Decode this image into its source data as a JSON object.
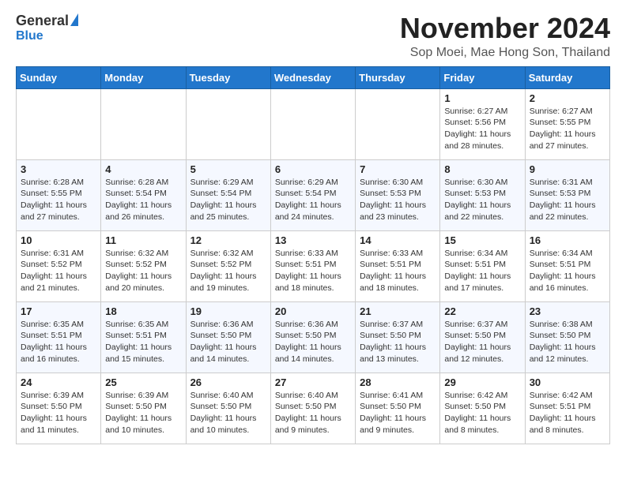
{
  "header": {
    "logo_general": "General",
    "logo_blue": "Blue",
    "month_title": "November 2024",
    "subtitle": "Sop Moei, Mae Hong Son, Thailand"
  },
  "days_of_week": [
    "Sunday",
    "Monday",
    "Tuesday",
    "Wednesday",
    "Thursday",
    "Friday",
    "Saturday"
  ],
  "weeks": [
    [
      {
        "day": "",
        "info": ""
      },
      {
        "day": "",
        "info": ""
      },
      {
        "day": "",
        "info": ""
      },
      {
        "day": "",
        "info": ""
      },
      {
        "day": "",
        "info": ""
      },
      {
        "day": "1",
        "info": "Sunrise: 6:27 AM\nSunset: 5:56 PM\nDaylight: 11 hours\nand 28 minutes."
      },
      {
        "day": "2",
        "info": "Sunrise: 6:27 AM\nSunset: 5:55 PM\nDaylight: 11 hours\nand 27 minutes."
      }
    ],
    [
      {
        "day": "3",
        "info": "Sunrise: 6:28 AM\nSunset: 5:55 PM\nDaylight: 11 hours\nand 27 minutes."
      },
      {
        "day": "4",
        "info": "Sunrise: 6:28 AM\nSunset: 5:54 PM\nDaylight: 11 hours\nand 26 minutes."
      },
      {
        "day": "5",
        "info": "Sunrise: 6:29 AM\nSunset: 5:54 PM\nDaylight: 11 hours\nand 25 minutes."
      },
      {
        "day": "6",
        "info": "Sunrise: 6:29 AM\nSunset: 5:54 PM\nDaylight: 11 hours\nand 24 minutes."
      },
      {
        "day": "7",
        "info": "Sunrise: 6:30 AM\nSunset: 5:53 PM\nDaylight: 11 hours\nand 23 minutes."
      },
      {
        "day": "8",
        "info": "Sunrise: 6:30 AM\nSunset: 5:53 PM\nDaylight: 11 hours\nand 22 minutes."
      },
      {
        "day": "9",
        "info": "Sunrise: 6:31 AM\nSunset: 5:53 PM\nDaylight: 11 hours\nand 22 minutes."
      }
    ],
    [
      {
        "day": "10",
        "info": "Sunrise: 6:31 AM\nSunset: 5:52 PM\nDaylight: 11 hours\nand 21 minutes."
      },
      {
        "day": "11",
        "info": "Sunrise: 6:32 AM\nSunset: 5:52 PM\nDaylight: 11 hours\nand 20 minutes."
      },
      {
        "day": "12",
        "info": "Sunrise: 6:32 AM\nSunset: 5:52 PM\nDaylight: 11 hours\nand 19 minutes."
      },
      {
        "day": "13",
        "info": "Sunrise: 6:33 AM\nSunset: 5:51 PM\nDaylight: 11 hours\nand 18 minutes."
      },
      {
        "day": "14",
        "info": "Sunrise: 6:33 AM\nSunset: 5:51 PM\nDaylight: 11 hours\nand 18 minutes."
      },
      {
        "day": "15",
        "info": "Sunrise: 6:34 AM\nSunset: 5:51 PM\nDaylight: 11 hours\nand 17 minutes."
      },
      {
        "day": "16",
        "info": "Sunrise: 6:34 AM\nSunset: 5:51 PM\nDaylight: 11 hours\nand 16 minutes."
      }
    ],
    [
      {
        "day": "17",
        "info": "Sunrise: 6:35 AM\nSunset: 5:51 PM\nDaylight: 11 hours\nand 16 minutes."
      },
      {
        "day": "18",
        "info": "Sunrise: 6:35 AM\nSunset: 5:51 PM\nDaylight: 11 hours\nand 15 minutes."
      },
      {
        "day": "19",
        "info": "Sunrise: 6:36 AM\nSunset: 5:50 PM\nDaylight: 11 hours\nand 14 minutes."
      },
      {
        "day": "20",
        "info": "Sunrise: 6:36 AM\nSunset: 5:50 PM\nDaylight: 11 hours\nand 14 minutes."
      },
      {
        "day": "21",
        "info": "Sunrise: 6:37 AM\nSunset: 5:50 PM\nDaylight: 11 hours\nand 13 minutes."
      },
      {
        "day": "22",
        "info": "Sunrise: 6:37 AM\nSunset: 5:50 PM\nDaylight: 11 hours\nand 12 minutes."
      },
      {
        "day": "23",
        "info": "Sunrise: 6:38 AM\nSunset: 5:50 PM\nDaylight: 11 hours\nand 12 minutes."
      }
    ],
    [
      {
        "day": "24",
        "info": "Sunrise: 6:39 AM\nSunset: 5:50 PM\nDaylight: 11 hours\nand 11 minutes."
      },
      {
        "day": "25",
        "info": "Sunrise: 6:39 AM\nSunset: 5:50 PM\nDaylight: 11 hours\nand 10 minutes."
      },
      {
        "day": "26",
        "info": "Sunrise: 6:40 AM\nSunset: 5:50 PM\nDaylight: 11 hours\nand 10 minutes."
      },
      {
        "day": "27",
        "info": "Sunrise: 6:40 AM\nSunset: 5:50 PM\nDaylight: 11 hours\nand 9 minutes."
      },
      {
        "day": "28",
        "info": "Sunrise: 6:41 AM\nSunset: 5:50 PM\nDaylight: 11 hours\nand 9 minutes."
      },
      {
        "day": "29",
        "info": "Sunrise: 6:42 AM\nSunset: 5:50 PM\nDaylight: 11 hours\nand 8 minutes."
      },
      {
        "day": "30",
        "info": "Sunrise: 6:42 AM\nSunset: 5:51 PM\nDaylight: 11 hours\nand 8 minutes."
      }
    ]
  ]
}
